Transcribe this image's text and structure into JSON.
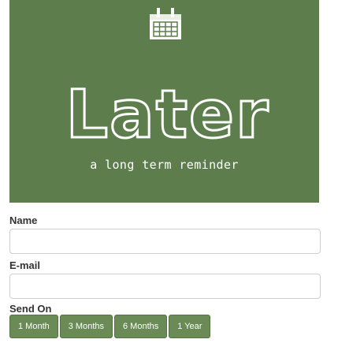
{
  "hero": {
    "logo_text": "Later",
    "tagline": "a long term reminder",
    "background_color": "#5d7e4c",
    "icon": "calendar-icon"
  },
  "form": {
    "name_label": "Name",
    "name_value": "",
    "email_label": "E-mail",
    "email_value": "",
    "send_on_label": "Send On",
    "periods": [
      "1 Month",
      "3 Months",
      "6 Months",
      "1 Year"
    ],
    "button_color": "#6a8a56"
  }
}
